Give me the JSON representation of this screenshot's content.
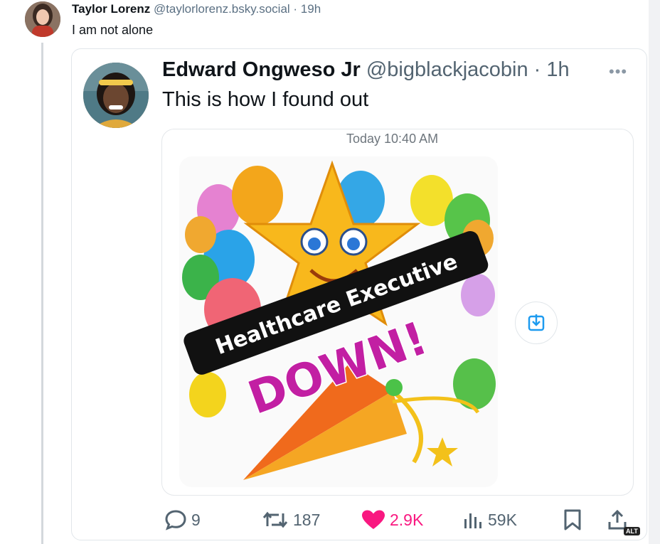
{
  "post": {
    "author_name": "Taylor Lorenz",
    "author_handle": "@taylorlorenz.bsky.social",
    "separator": " · ",
    "time": "19h",
    "text": "I am not alone"
  },
  "quote": {
    "author_name": "Edward Ongweso Jr",
    "author_handle": "@bigblackjacobin",
    "separator": " · ",
    "time": "1h",
    "text": "This is how I found out",
    "more_icon": "•••",
    "media": {
      "timestamp": "Today 10:40 AM",
      "image_text_line1": "Healthcare Executive",
      "image_text_line2": "DOWN!"
    }
  },
  "actions": {
    "replies": "9",
    "reposts": "187",
    "likes": "2.9K",
    "views": "59K",
    "alt_badge": "ALT"
  },
  "colors": {
    "like": "#f91880",
    "muted": "#536471",
    "border": "#e1e6ea"
  }
}
